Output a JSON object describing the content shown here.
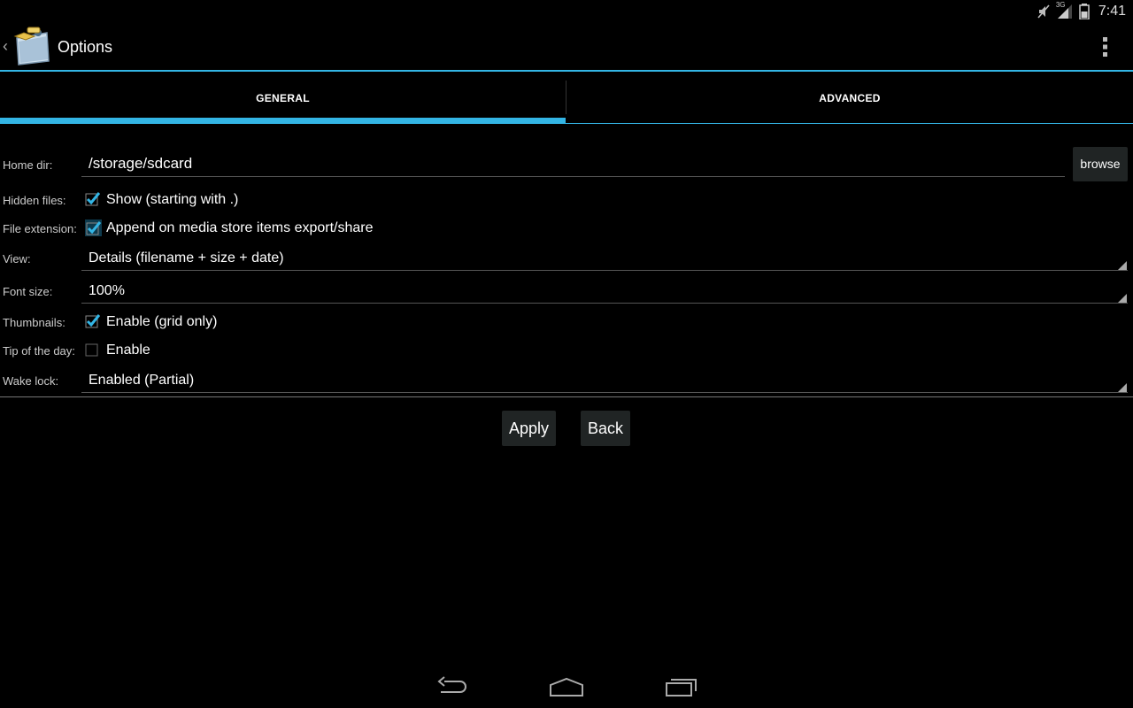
{
  "status_bar": {
    "time": "7:41",
    "network": "3G",
    "icons": [
      "mute-icon",
      "signal-icon",
      "battery-icon"
    ]
  },
  "action_bar": {
    "title": "Options",
    "icons": [
      "up-caret-icon",
      "app-icon",
      "overflow-menu-icon"
    ]
  },
  "tabs": [
    {
      "label": "GENERAL",
      "selected": true
    },
    {
      "label": "ADVANCED",
      "selected": false
    }
  ],
  "form": {
    "home_dir": {
      "label": "Home dir:",
      "value": "/storage/sdcard",
      "button": "browse"
    },
    "hidden_files": {
      "label": "Hidden files:",
      "option": "Show (starting with .)",
      "checked": true
    },
    "file_extension": {
      "label": "File extension:",
      "option": "Append on media store items export/share",
      "checked": true
    },
    "view": {
      "label": "View:",
      "value": "Details (filename + size + date)"
    },
    "font_size": {
      "label": "Font size:",
      "value": "100%"
    },
    "thumbnails": {
      "label": "Thumbnails:",
      "option": "Enable (grid only)",
      "checked": true
    },
    "tip_of_day": {
      "label": "Tip of the day:",
      "option": "Enable",
      "checked": false
    },
    "wake_lock": {
      "label": "Wake lock:",
      "value": "Enabled (Partial)"
    }
  },
  "buttons": {
    "apply": "Apply",
    "back": "Back"
  },
  "nav_bar": {
    "icons": [
      "back-nav-icon",
      "home-nav-icon",
      "recents-nav-icon"
    ]
  },
  "colors": {
    "accent": "#33b5e5",
    "background": "#000000",
    "button": "#202424"
  }
}
